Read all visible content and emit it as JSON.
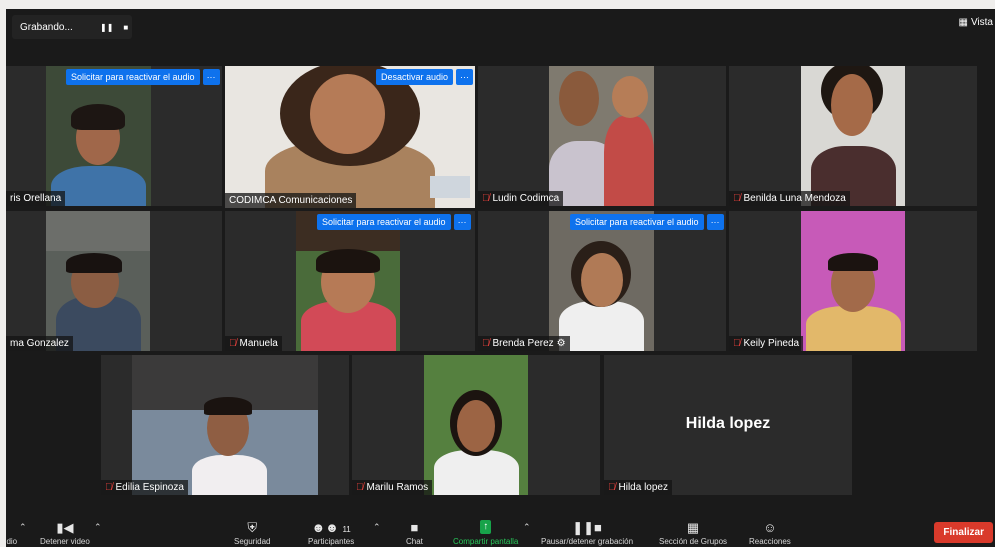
{
  "recording": {
    "label": "Grabando...",
    "pause_icon": "pause-icon",
    "stop_icon": "stop-icon"
  },
  "view": {
    "label": "Vista",
    "icon": "grid-icon"
  },
  "participants": [
    {
      "name": "ris Orellana",
      "muted": false,
      "badge": "Solicitar para reactivar el audio",
      "more": "···",
      "active": false
    },
    {
      "name": "CODIMCA Comunicaciones",
      "muted": false,
      "badge": "Desactivar audio",
      "more": "···",
      "active": true
    },
    {
      "name": "Ludin Codimca",
      "muted": true,
      "badge": "",
      "more": "",
      "active": false
    },
    {
      "name": "Benilda Luna Mendoza",
      "muted": true,
      "badge": "",
      "more": "",
      "active": false
    },
    {
      "name": "ma Gonzalez",
      "muted": false,
      "badge": "",
      "more": "",
      "active": false
    },
    {
      "name": "Manuela",
      "muted": true,
      "badge": "Solicitar para reactivar el audio",
      "more": "···",
      "active": false
    },
    {
      "name": "Brenda Perez",
      "muted": true,
      "badge": "Solicitar para reactivar el audio",
      "more": "···",
      "active": false
    },
    {
      "name": "Keily Pineda",
      "muted": true,
      "badge": "",
      "more": "",
      "active": false
    },
    {
      "name": "Edilia Espinoza",
      "muted": true,
      "badge": "",
      "more": "",
      "active": false
    },
    {
      "name": "Marilu Ramos",
      "muted": true,
      "badge": "",
      "more": "",
      "active": false
    },
    {
      "name": "Hilda lopez",
      "muted": true,
      "badge": "",
      "more": "",
      "active": false,
      "no_video_label": "Hilda lopez"
    }
  ],
  "toolbar": {
    "audio": "udio",
    "video": "Detener video",
    "security": "Seguridad",
    "participants": "Participantes",
    "participants_count": "11",
    "chat": "Chat",
    "share": "Compartir pantalla",
    "record": "Pausar/detener grabación",
    "breakout": "Sección de Grupos",
    "reactions": "Reacciones",
    "end": "Finalizar"
  },
  "colors": {
    "accent": "#0e72ed",
    "active_border": "#c6e04e",
    "share_green": "#17a34a",
    "end_red": "#d93a2b",
    "muted_red": "#e8413c"
  }
}
